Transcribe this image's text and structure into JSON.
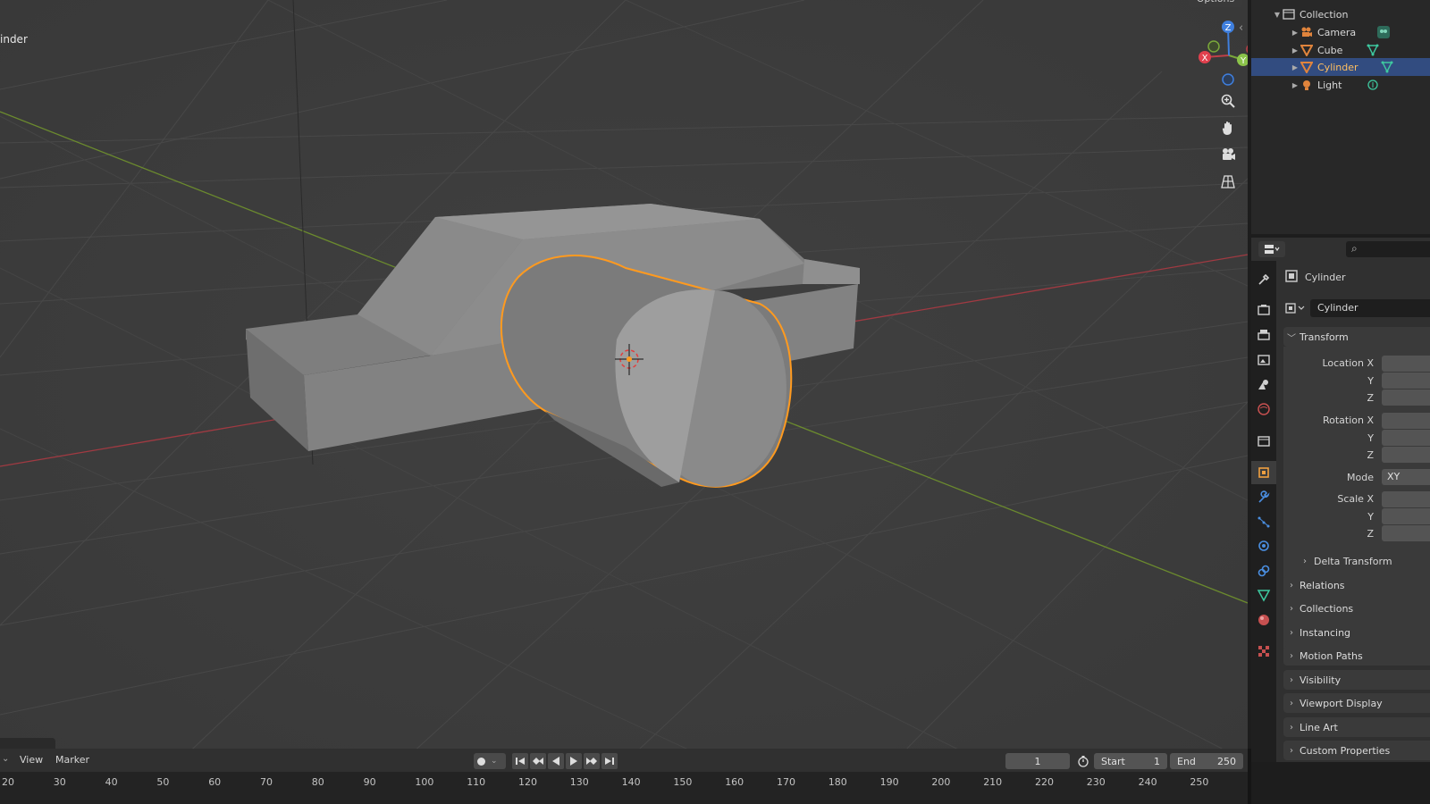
{
  "viewport": {
    "object_label": "inder",
    "options_label": "Options"
  },
  "outliner": {
    "collection": "Collection",
    "items": [
      {
        "name": "Camera",
        "icon": "camera-icon",
        "color": "#e0843c"
      },
      {
        "name": "Cube",
        "icon": "mesh-icon",
        "color": "#e0843c"
      },
      {
        "name": "Cylinder",
        "icon": "mesh-icon",
        "color": "#e0843c",
        "selected": true
      },
      {
        "name": "Light",
        "icon": "light-icon",
        "color": "#e0843c"
      }
    ]
  },
  "properties": {
    "object_name": "Cylinder",
    "data_name": "Cylinder",
    "transform_label": "Transform",
    "location_x": "Location X",
    "rotation_x": "Rotation X",
    "scale_x": "Scale X",
    "axis_y": "Y",
    "axis_z": "Z",
    "mode_label": "Mode",
    "mode_value": "XY",
    "delta_transform": "Delta Transform",
    "panels": [
      "Relations",
      "Collections",
      "Instancing",
      "Motion Paths",
      "Visibility",
      "Viewport Display",
      "Line Art",
      "Custom Properties"
    ]
  },
  "timeline": {
    "view_menu": "View",
    "marker_menu": "Marker",
    "current_frame": "1",
    "start_label": "Start",
    "start_value": "1",
    "end_label": "End",
    "end_value": "250",
    "ticks": [
      "20",
      "30",
      "40",
      "50",
      "60",
      "70",
      "80",
      "90",
      "100",
      "110",
      "120",
      "130",
      "140",
      "150",
      "160",
      "170",
      "180",
      "190",
      "200",
      "210",
      "220",
      "230",
      "240",
      "250"
    ]
  },
  "colors": {
    "selection_outline": "#ff9a1f",
    "x_axis": "#e0404e",
    "y_axis": "#8bc34a",
    "z_axis": "#3f7fde",
    "selected_row": "#324c80"
  }
}
